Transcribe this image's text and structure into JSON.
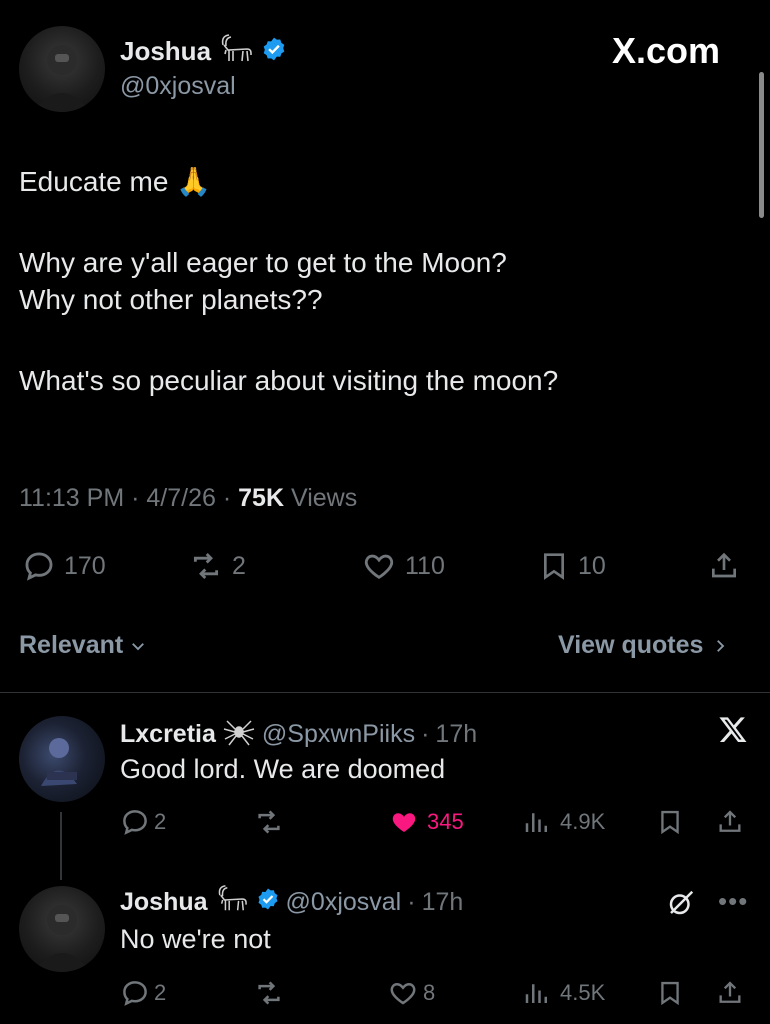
{
  "brand": {
    "site_label": "X.com"
  },
  "tweet": {
    "author_name": "Joshua",
    "author_handle": "@0xjosval",
    "lines": [
      "Educate me 🙏",
      "Why are y'all eager to get to the Moon?",
      "Why not other planets??",
      "What's so peculiar about visiting the moon?"
    ],
    "time": "11:13 PM",
    "date": "4/7/26",
    "views_count": "75K",
    "views_label": "Views",
    "replies": "170",
    "reposts": "2",
    "likes": "110",
    "bookmarks": "10"
  },
  "filters": {
    "sort_label": "Relevant",
    "quotes_label": "View quotes"
  },
  "replies": [
    {
      "name": "Lxcretia",
      "handle": "@SpxwnPiiks",
      "age": "17h",
      "text": "Good lord. We are doomed",
      "replies": "2",
      "likes": "345",
      "views": "4.9K",
      "liked": true
    },
    {
      "name": "Joshua",
      "handle": "@0xjosval",
      "age": "17h",
      "text": "No we're not",
      "replies": "2",
      "likes": "8",
      "views": "4.5K",
      "liked": false
    }
  ],
  "colors": {
    "like_active": "#f91880",
    "verified": "#1d9bf0",
    "muted": "#71767b"
  }
}
